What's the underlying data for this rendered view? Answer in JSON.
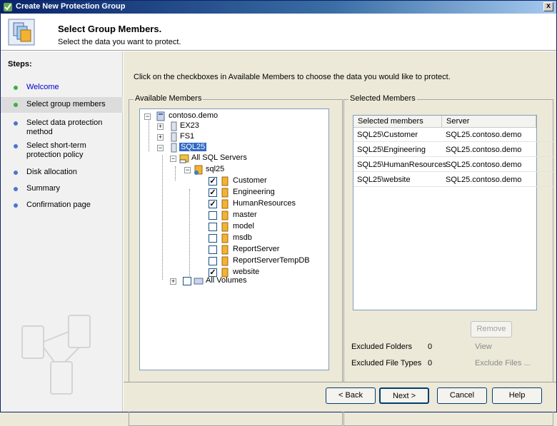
{
  "window": {
    "title": "Create New Protection Group",
    "close_label": "x"
  },
  "header": {
    "title": "Select Group Members.",
    "subtitle": "Select the data you want to protect."
  },
  "steps": {
    "title": "Steps:",
    "items": [
      {
        "label": "Welcome"
      },
      {
        "label": "Select group members"
      },
      {
        "label": "Select data protection method"
      },
      {
        "label": "Select short-term protection policy"
      },
      {
        "label": "Disk allocation"
      },
      {
        "label": "Summary"
      },
      {
        "label": "Confirmation page"
      }
    ]
  },
  "main": {
    "instruction": "Click on the checkboxes in Available Members to choose the data you would like to protect.",
    "available_title": "Available Members",
    "selected_title": "Selected Members"
  },
  "tree": {
    "root": "contoso.demo",
    "ex23": "EX23",
    "fs1": "FS1",
    "sql25": "SQL25",
    "all_sql": "All SQL Servers",
    "instance": "sql25",
    "dbs": [
      {
        "name": "Customer",
        "checked": true
      },
      {
        "name": "Engineering",
        "checked": true
      },
      {
        "name": "HumanResources",
        "checked": true
      },
      {
        "name": "master",
        "checked": false
      },
      {
        "name": "model",
        "checked": false
      },
      {
        "name": "msdb",
        "checked": false
      },
      {
        "name": "ReportServer",
        "checked": false
      },
      {
        "name": "ReportServerTempDB",
        "checked": false
      },
      {
        "name": "website",
        "checked": true
      }
    ],
    "all_volumes": "All Volumes"
  },
  "selected": {
    "columns": [
      "Selected members",
      "Server"
    ],
    "rows": [
      [
        "SQL25\\Customer",
        "SQL25.contoso.demo"
      ],
      [
        "SQL25\\Engineering",
        "SQL25.contoso.demo"
      ],
      [
        "SQL25\\HumanResources",
        "SQL25.contoso.demo"
      ],
      [
        "SQL25\\website",
        "SQL25.contoso.demo"
      ]
    ],
    "remove_label": "Remove",
    "excluded_folders_label": "Excluded Folders",
    "excluded_folders_count": "0",
    "view_label": "View",
    "excluded_types_label": "Excluded File Types",
    "excluded_types_count": "0",
    "exclude_files_label": "Exclude Files ..."
  },
  "footer": {
    "back": "< Back",
    "next": "Next >",
    "cancel": "Cancel",
    "help": "Help"
  }
}
